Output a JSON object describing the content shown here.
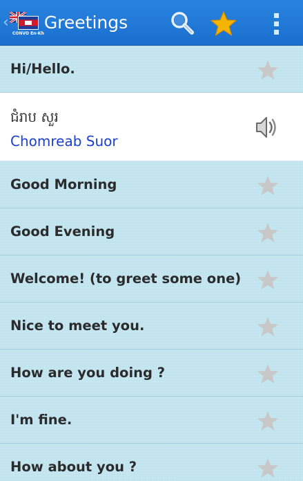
{
  "action_bar": {
    "title": "Greetings",
    "logo_text": "CONVO En-Kh"
  },
  "colors": {
    "action_bar": "#1f78d6",
    "list_background": "#bfe3ef",
    "expanded_background": "#ffffff",
    "favorite_star": "#f5b400",
    "row_star": "#c8c8c8",
    "transliteration": "#1b3fd0"
  },
  "icons": {
    "up": "chevron-left-icon",
    "search": "search-icon",
    "favorites": "star-icon",
    "menu": "overflow-menu-icon",
    "row_favorite": "star-icon",
    "audio": "speaker-icon"
  },
  "phrases": [
    {
      "label": "Hi/Hello."
    },
    {
      "khmer": "ជំរាប សួរ",
      "transliteration": "Chomreab Suor"
    },
    {
      "label": "Good Morning"
    },
    {
      "label": "Good Evening"
    },
    {
      "label": "Welcome! (to greet some one)"
    },
    {
      "label": "Nice to meet you."
    },
    {
      "label": "How are you doing ?"
    },
    {
      "label": "I'm fine."
    },
    {
      "label": "How about you ?"
    }
  ]
}
